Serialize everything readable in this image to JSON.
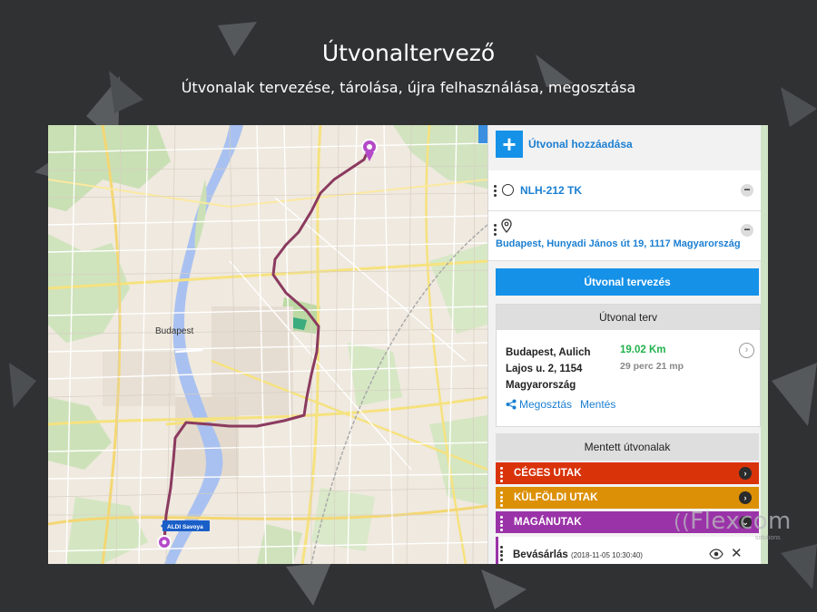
{
  "header": {
    "title": "Útvonaltervező",
    "subtitle": "Útvonalak tervezése, tárolása, újra felhasználása, megosztása"
  },
  "map": {
    "city_label": "Budapest",
    "marker_label": "ALDI Savoya",
    "route_color": "#8b3a5f",
    "river_color": "#a9c1f0"
  },
  "panel": {
    "add_route_label": "Útvonal hozzáadása",
    "waypoints": [
      {
        "label": "NLH-212 TK",
        "icon": "circle-icon"
      },
      {
        "label": "Budapest, Hunyadi János út 19, 1117 Magyarország",
        "icon": "pin-icon"
      }
    ],
    "plan_button": "Útvonal tervezés",
    "plan_card": {
      "header": "Útvonal terv",
      "address": "Budapest, Aulich Lajos u. 2, 1154 Magyarország",
      "distance": "19.02 Km",
      "duration": "29 perc 21 mp",
      "share_label": "Megosztás",
      "save_label": "Mentés"
    },
    "saved_routes": {
      "header": "Mentett útvonalak",
      "categories": [
        {
          "label": "CÉGES UTAK",
          "color": "#d9330a"
        },
        {
          "label": "KÜLFÖLDI UTAK",
          "color": "#dc9006"
        },
        {
          "label": "MAGÁNUTAK",
          "color": "#9b33a8"
        }
      ],
      "item": {
        "title": "Bevásárlás",
        "date": "(2018-11-05 10:30:40)"
      }
    }
  },
  "watermark": {
    "brand": "Flexcom",
    "tagline": "solutions"
  }
}
